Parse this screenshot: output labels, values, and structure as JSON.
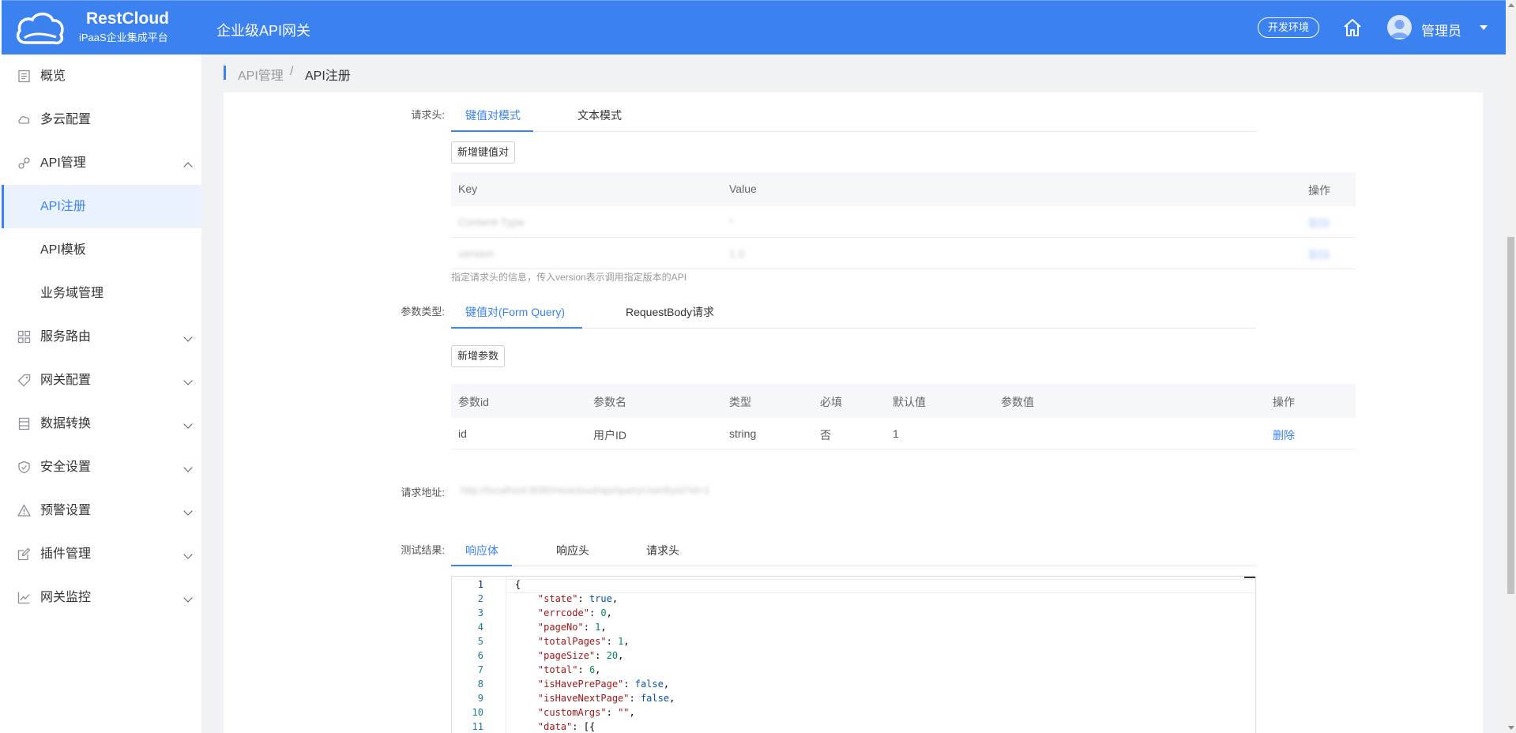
{
  "header": {
    "brand_name": "RestCloud",
    "brand_sub": "iPaaS企业集成平台",
    "title": "企业级API网关",
    "env_button": "开发环境",
    "user_name": "管理员"
  },
  "sidebar": {
    "items": [
      {
        "label": "概览",
        "icon": "overview-icon"
      },
      {
        "label": "多云配置",
        "icon": "cloud-icon"
      },
      {
        "label": "API管理",
        "icon": "api-icon"
      },
      {
        "label": "API注册"
      },
      {
        "label": "API模板"
      },
      {
        "label": "业务域管理"
      },
      {
        "label": "服务路由",
        "icon": "grid-icon"
      },
      {
        "label": "网关配置",
        "icon": "tag-icon"
      },
      {
        "label": "数据转换",
        "icon": "database-icon"
      },
      {
        "label": "安全设置",
        "icon": "shield-icon"
      },
      {
        "label": "预警设置",
        "icon": "warning-icon"
      },
      {
        "label": "插件管理",
        "icon": "edit-icon"
      },
      {
        "label": "网关监控",
        "icon": "chart-icon"
      }
    ]
  },
  "breadcrumb": {
    "parent": "API管理",
    "separator": "/",
    "current": "API注册"
  },
  "request_headers": {
    "label": "请求头:",
    "tabs": [
      "键值对模式",
      "文本模式"
    ],
    "add_button": "新增键值对",
    "columns": [
      "Key",
      "Value",
      "操作"
    ],
    "rows": [
      {
        "key": "Content-Type",
        "value": "*",
        "action": "删除"
      },
      {
        "key": "version",
        "value": "1.0",
        "action": "删除"
      }
    ],
    "hint": "指定请求头的信息，传入version表示调用指定版本的API"
  },
  "params": {
    "label": "参数类型:",
    "tabs": [
      "键值对(Form Query)",
      "RequestBody请求"
    ],
    "add_button": "新增参数",
    "columns": [
      "参数id",
      "参数名",
      "类型",
      "必填",
      "默认值",
      "参数值",
      "操作"
    ],
    "rows": [
      {
        "id": "id",
        "name": "用户ID",
        "type": "string",
        "required": "否",
        "default": "1",
        "value": "",
        "action": "删除"
      }
    ]
  },
  "request_url": {
    "label": "请求地址:",
    "value": "http://localhost:8080/restcloud/api/queryUserById?id=1"
  },
  "test_result": {
    "label": "测试结果:",
    "tabs": [
      "响应体",
      "响应头",
      "请求头"
    ],
    "code_lines": [
      {
        "n": "1",
        "text": "{"
      },
      {
        "n": "2",
        "k": "\"state\"",
        "v": "true",
        "t": "b"
      },
      {
        "n": "3",
        "k": "\"errcode\"",
        "v": "0",
        "t": "n"
      },
      {
        "n": "4",
        "k": "\"pageNo\"",
        "v": "1",
        "t": "n"
      },
      {
        "n": "5",
        "k": "\"totalPages\"",
        "v": "1",
        "t": "n"
      },
      {
        "n": "6",
        "k": "\"pageSize\"",
        "v": "20",
        "t": "n"
      },
      {
        "n": "7",
        "k": "\"total\"",
        "v": "6",
        "t": "n"
      },
      {
        "n": "8",
        "k": "\"isHavePrePage\"",
        "v": "false",
        "t": "b"
      },
      {
        "n": "9",
        "k": "\"isHaveNextPage\"",
        "v": "false",
        "t": "b"
      },
      {
        "n": "10",
        "k": "\"customArgs\"",
        "v": "\"\"",
        "t": "s"
      },
      {
        "n": "11",
        "k": "\"data\"",
        "v": "[{",
        "t": "p"
      }
    ]
  },
  "colors": {
    "primary": "#3b82f0",
    "header_bg": "#3b82f0"
  }
}
